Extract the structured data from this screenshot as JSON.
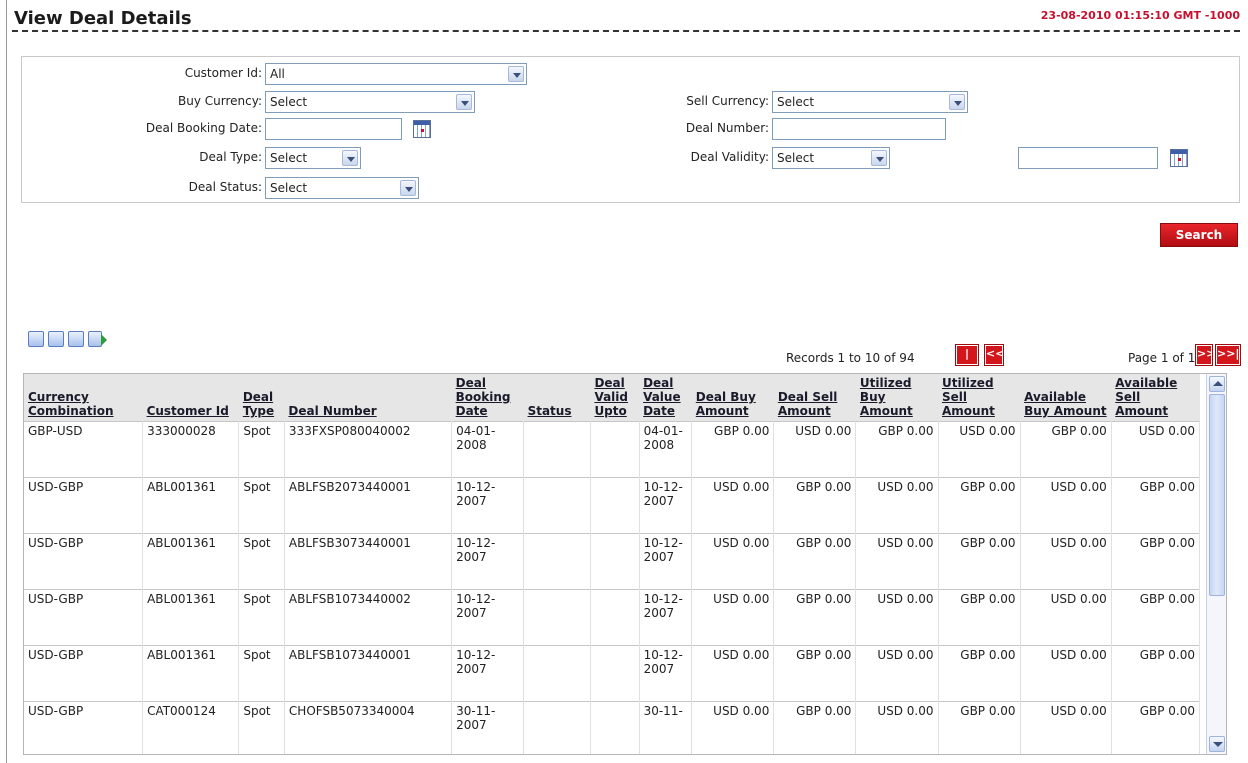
{
  "header": {
    "title": "View Deal Details",
    "datetime": "23-08-2010 01:15:10 GMT -1000"
  },
  "filters": {
    "customer_id": {
      "label": "Customer Id:",
      "value": "All"
    },
    "buy_currency": {
      "label": "Buy Currency:",
      "value": "Select"
    },
    "sell_currency": {
      "label": "Sell Currency:",
      "value": "Select"
    },
    "deal_booking_date": {
      "label": "Deal Booking Date:",
      "value": ""
    },
    "deal_number": {
      "label": "Deal Number:",
      "value": ""
    },
    "deal_type": {
      "label": "Deal Type:",
      "value": "Select"
    },
    "deal_validity": {
      "label": "Deal Validity:",
      "value": "Select"
    },
    "deal_validity_date": {
      "value": ""
    },
    "deal_status": {
      "label": "Deal Status:",
      "value": "Select"
    }
  },
  "search_label": "Search",
  "toolbar": {
    "icons": [
      "edit-icon",
      "download-icon",
      "print-icon",
      "export-icon"
    ]
  },
  "pagination": {
    "records": "Records 1 to 10 of 94",
    "first": "|<<",
    "prev": "<<",
    "page_info": "Page 1 of 10",
    "next": ">>",
    "last": ">>|"
  },
  "table": {
    "headers": [
      "Currency Combination",
      "Customer Id",
      "Deal Type",
      "Deal Number",
      "Deal Booking Date",
      "Status",
      "Deal Valid Upto",
      "Deal Value Date",
      "Deal Buy Amount",
      "Deal Sell Amount",
      "Utilized Buy Amount",
      "Utilized Sell Amount",
      "Available Buy Amount",
      "Available Sell Amount"
    ],
    "rows": [
      [
        "GBP-USD",
        "333000028",
        "Spot",
        "333FXSP080040002",
        "04-01-2008",
        "",
        "",
        "04-01-2008",
        "GBP 0.00",
        "USD 0.00",
        "GBP 0.00",
        "USD 0.00",
        "GBP 0.00",
        "USD 0.00"
      ],
      [
        "USD-GBP",
        "ABL001361",
        "Spot",
        "ABLFSB2073440001",
        "10-12-2007",
        "",
        "",
        "10-12-2007",
        "USD 0.00",
        "GBP 0.00",
        "USD 0.00",
        "GBP 0.00",
        "USD 0.00",
        "GBP 0.00"
      ],
      [
        "USD-GBP",
        "ABL001361",
        "Spot",
        "ABLFSB3073440001",
        "10-12-2007",
        "",
        "",
        "10-12-2007",
        "USD 0.00",
        "GBP 0.00",
        "USD 0.00",
        "GBP 0.00",
        "USD 0.00",
        "GBP 0.00"
      ],
      [
        "USD-GBP",
        "ABL001361",
        "Spot",
        "ABLFSB1073440002",
        "10-12-2007",
        "",
        "",
        "10-12-2007",
        "USD 0.00",
        "GBP 0.00",
        "USD 0.00",
        "GBP 0.00",
        "USD 0.00",
        "GBP 0.00"
      ],
      [
        "USD-GBP",
        "ABL001361",
        "Spot",
        "ABLFSB1073440001",
        "10-12-2007",
        "",
        "",
        "10-12-2007",
        "USD 0.00",
        "GBP 0.00",
        "USD 0.00",
        "GBP 0.00",
        "USD 0.00",
        "GBP 0.00"
      ],
      [
        "USD-GBP",
        "CAT000124",
        "Spot",
        "CHOFSB5073340004",
        "30-11-2007",
        "",
        "",
        "30-11-",
        "USD 0.00",
        "GBP 0.00",
        "USD 0.00",
        "GBP 0.00",
        "USD 0.00",
        "GBP 0.00"
      ]
    ]
  }
}
